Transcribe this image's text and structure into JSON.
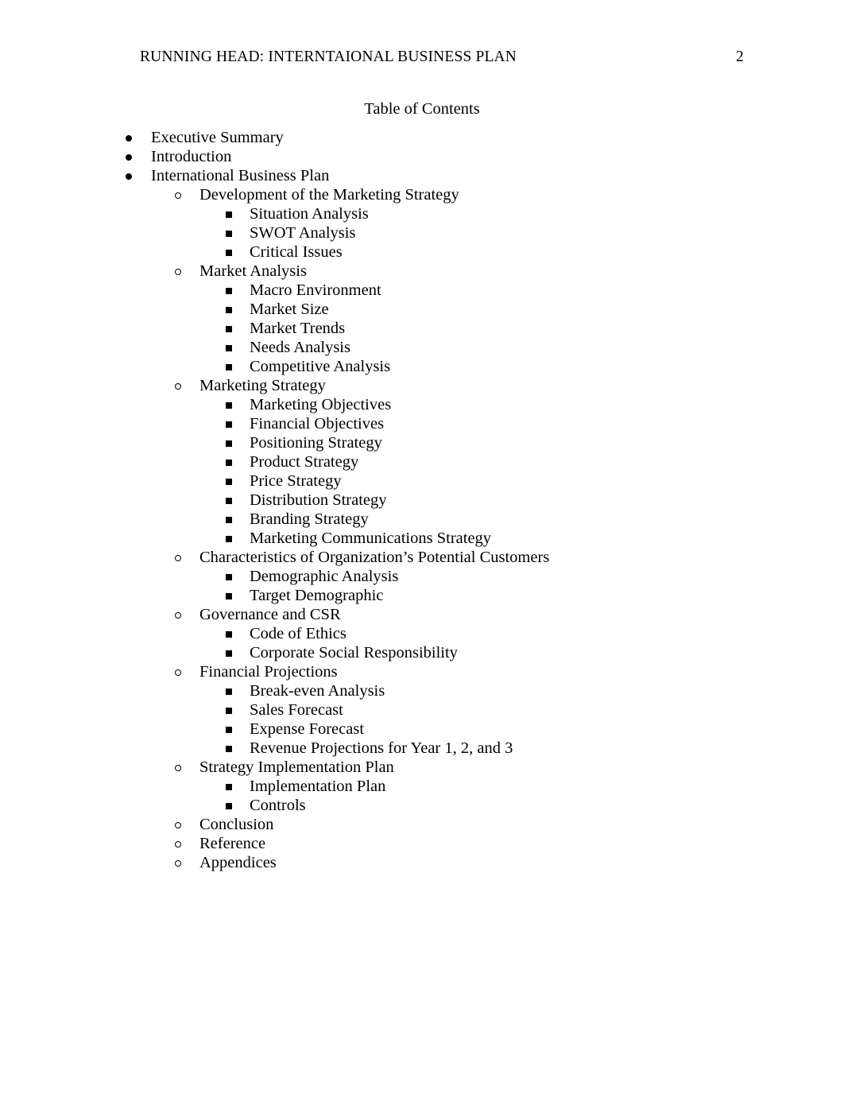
{
  "header": {
    "running_head": "RUNNING HEAD: INTERNTAIONAL BUSINESS PLAN",
    "page_number": "2"
  },
  "title": "Table of Contents",
  "bullets": {
    "level1_icon": "filled-disc-bullet-icon",
    "level2_icon": "hollow-circle-bullet-icon",
    "level3_icon": "filled-square-bullet-icon"
  },
  "toc": {
    "items": [
      {
        "level": 1,
        "label": "Executive Summary"
      },
      {
        "level": 1,
        "label": "Introduction"
      },
      {
        "level": 1,
        "label": "International Business Plan"
      },
      {
        "level": 2,
        "label": "Development of the Marketing Strategy"
      },
      {
        "level": 3,
        "label": "Situation Analysis"
      },
      {
        "level": 3,
        "label": "SWOT Analysis"
      },
      {
        "level": 3,
        "label": "Critical Issues"
      },
      {
        "level": 2,
        "label": "Market Analysis"
      },
      {
        "level": 3,
        "label": "Macro Environment"
      },
      {
        "level": 3,
        "label": "Market Size"
      },
      {
        "level": 3,
        "label": "Market Trends"
      },
      {
        "level": 3,
        "label": "Needs Analysis"
      },
      {
        "level": 3,
        "label": "Competitive Analysis"
      },
      {
        "level": 2,
        "label": "Marketing Strategy"
      },
      {
        "level": 3,
        "label": "Marketing Objectives"
      },
      {
        "level": 3,
        "label": "Financial Objectives"
      },
      {
        "level": 3,
        "label": "Positioning Strategy"
      },
      {
        "level": 3,
        "label": "Product Strategy"
      },
      {
        "level": 3,
        "label": "Price Strategy"
      },
      {
        "level": 3,
        "label": "Distribution Strategy"
      },
      {
        "level": 3,
        "label": "Branding Strategy"
      },
      {
        "level": 3,
        "label": "Marketing Communications Strategy"
      },
      {
        "level": 2,
        "label": "Characteristics of Organization’s Potential Customers"
      },
      {
        "level": 3,
        "label": "Demographic Analysis"
      },
      {
        "level": 3,
        "label": "Target Demographic"
      },
      {
        "level": 2,
        "label": "Governance and CSR"
      },
      {
        "level": 3,
        "label": "Code of Ethics"
      },
      {
        "level": 3,
        "label": "Corporate Social Responsibility"
      },
      {
        "level": 2,
        "label": "Financial Projections"
      },
      {
        "level": 3,
        "label": "Break-even Analysis"
      },
      {
        "level": 3,
        "label": "Sales Forecast"
      },
      {
        "level": 3,
        "label": "Expense Forecast"
      },
      {
        "level": 3,
        "label": "Revenue Projections for Year 1, 2, and 3"
      },
      {
        "level": 2,
        "label": "Strategy Implementation Plan"
      },
      {
        "level": 3,
        "label": "Implementation Plan"
      },
      {
        "level": 3,
        "label": "Controls"
      },
      {
        "level": 2,
        "label": "Conclusion"
      },
      {
        "level": 2,
        "label": "Reference"
      },
      {
        "level": 2,
        "label": "Appendices"
      }
    ]
  }
}
